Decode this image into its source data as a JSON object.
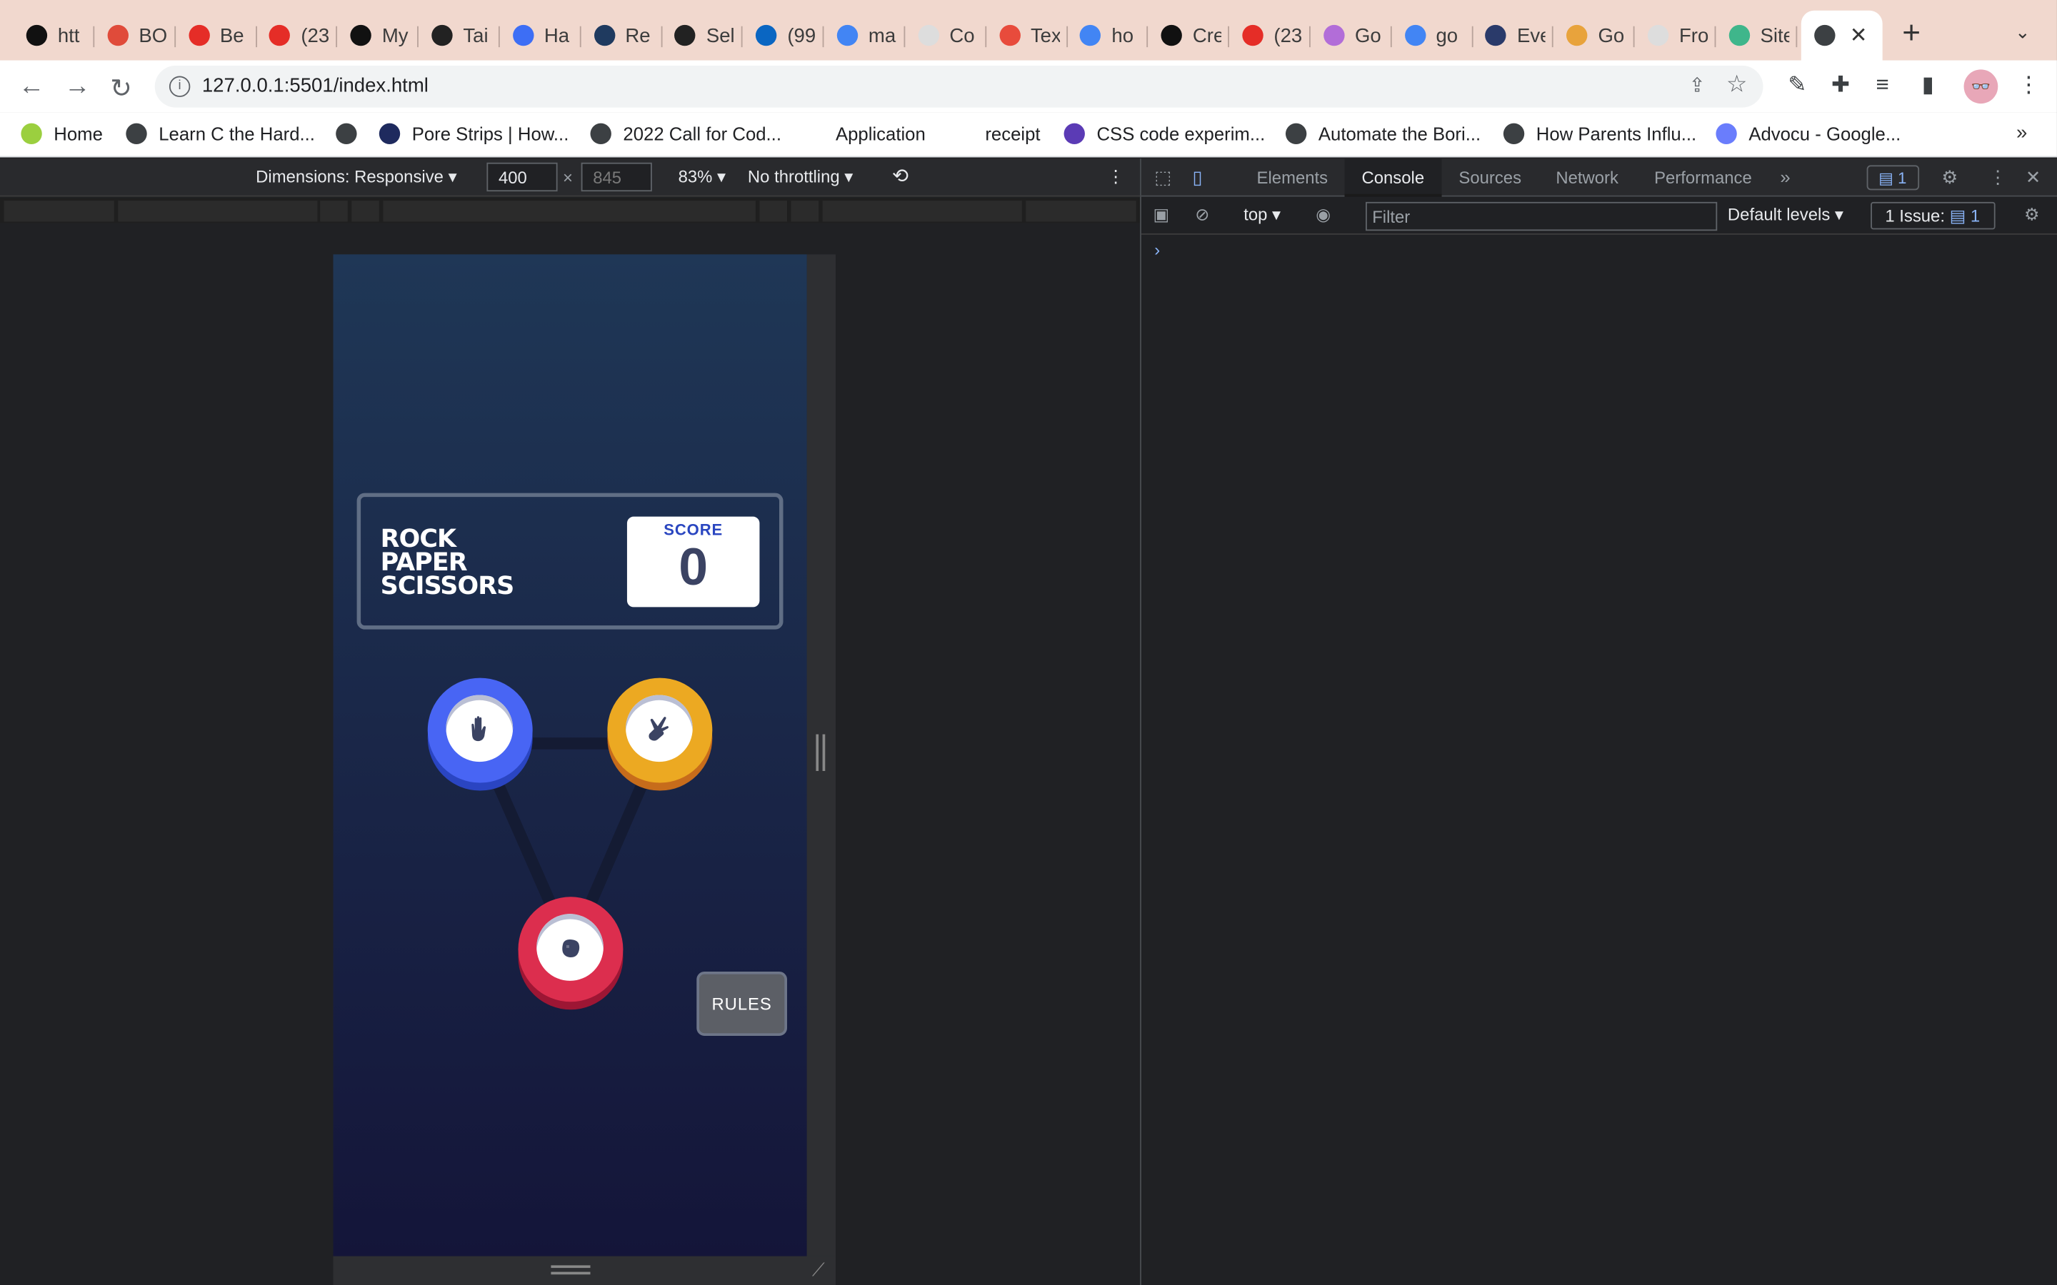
{
  "browser": {
    "tabs": [
      {
        "title": "htt",
        "color": "#111111"
      },
      {
        "title": "BO",
        "color": "#e04b3a"
      },
      {
        "title": "Be",
        "color": "#e52d27"
      },
      {
        "title": "(23",
        "color": "#e52d27"
      },
      {
        "title": "My",
        "color": "#111111"
      },
      {
        "title": "Tai",
        "color": "#222222"
      },
      {
        "title": "Ha",
        "color": "#3d6ef5"
      },
      {
        "title": "Re",
        "color": "#1f3a5f"
      },
      {
        "title": "Sel",
        "color": "#222222"
      },
      {
        "title": "(99",
        "color": "#0a66c2"
      },
      {
        "title": "ma",
        "color": "#4285f4"
      },
      {
        "title": "Co",
        "color": "#dddddd"
      },
      {
        "title": "Tex",
        "color": "#e84b3c"
      },
      {
        "title": "ho",
        "color": "#4285f4"
      },
      {
        "title": "Cre",
        "color": "#111111"
      },
      {
        "title": "(23",
        "color": "#e52d27"
      },
      {
        "title": "Go",
        "color": "#b26dd8"
      },
      {
        "title": "go",
        "color": "#4285f4"
      },
      {
        "title": "Eve",
        "color": "#2a3a6a"
      },
      {
        "title": "Go",
        "color": "#e8a33c"
      },
      {
        "title": "Fro",
        "color": "#dddddd"
      },
      {
        "title": "Site",
        "color": "#3fb68b"
      }
    ],
    "url": "127.0.0.1:5501/index.html",
    "bookmarks": [
      {
        "label": "Home"
      },
      {
        "label": "Learn C the Hard..."
      },
      {
        "label": ""
      },
      {
        "label": "Pore Strips | How..."
      },
      {
        "label": "2022 Call for Cod..."
      },
      {
        "label": "Application"
      },
      {
        "label": "receipt"
      },
      {
        "label": "CSS code experim..."
      },
      {
        "label": "Automate the Bori..."
      },
      {
        "label": "How Parents Influ..."
      },
      {
        "label": "Advocu - Google..."
      }
    ],
    "more_bookmarks": "»"
  },
  "device_toolbar": {
    "dimensions_label": "Dimensions: Responsive",
    "width": "400",
    "height": "845",
    "times": "×",
    "zoom": "83%",
    "throttling": "No throttling"
  },
  "game": {
    "title_lines": [
      "ROCK",
      "PAPER",
      "SCISSORS"
    ],
    "score_label": "SCORE",
    "score_value": "0",
    "rules_label": "RULES",
    "colors": {
      "paper": "#4865f4",
      "scissors": "#eca922",
      "rock": "#dc2e4e"
    }
  },
  "devtools": {
    "tabs": [
      "Elements",
      "Console",
      "Sources",
      "Network",
      "Performance"
    ],
    "active_tab": "Console",
    "more_tabs": "»",
    "messages_badge": "1",
    "context": "top",
    "filter_placeholder": "Filter",
    "levels": "Default levels",
    "issues_label": "1 Issue:",
    "issues_count": "1",
    "prompt": "›"
  }
}
